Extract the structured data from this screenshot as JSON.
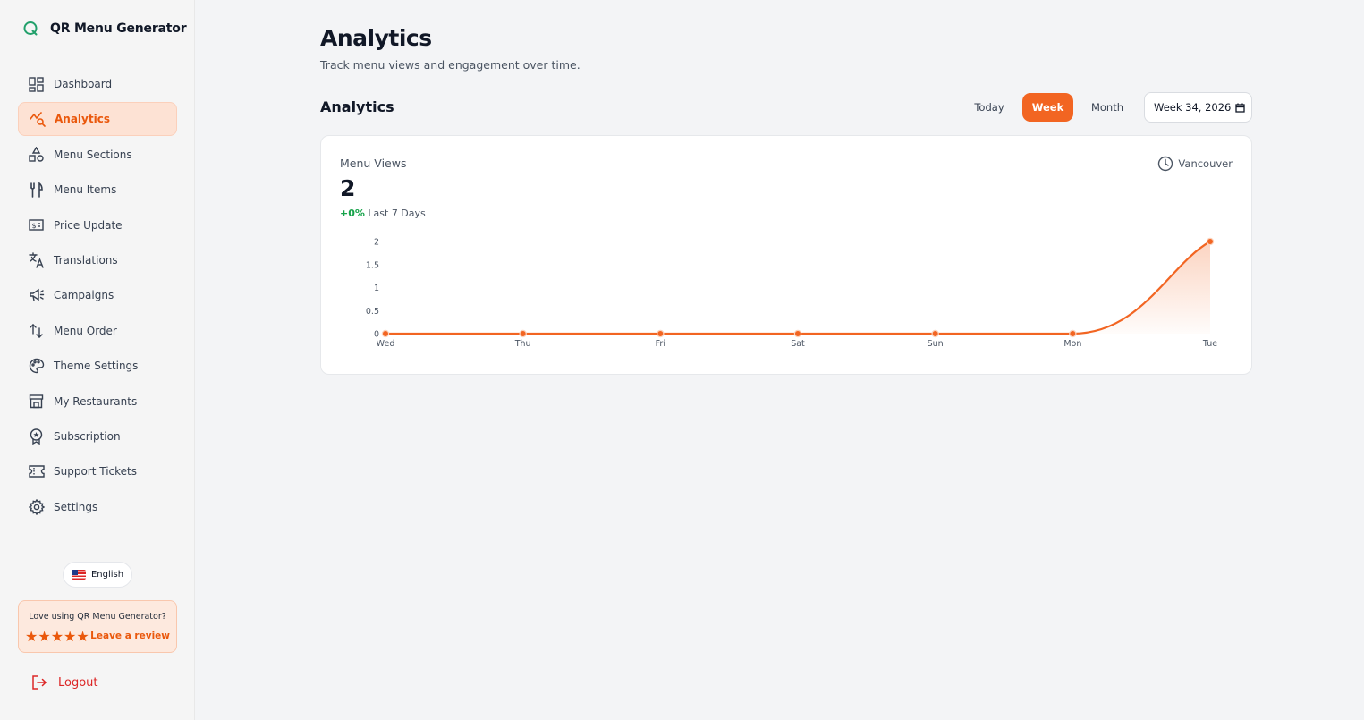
{
  "brand": {
    "name": "QR Menu Generator"
  },
  "sidebar": {
    "items": [
      {
        "label": "Dashboard",
        "icon": "dashboard-icon"
      },
      {
        "label": "Analytics",
        "icon": "analytics-icon",
        "active": true
      },
      {
        "label": "Menu Sections",
        "icon": "shapes-icon"
      },
      {
        "label": "Menu Items",
        "icon": "utensils-icon"
      },
      {
        "label": "Price Update",
        "icon": "price-tag-icon"
      },
      {
        "label": "Translations",
        "icon": "translate-icon"
      },
      {
        "label": "Campaigns",
        "icon": "megaphone-icon"
      },
      {
        "label": "Menu Order",
        "icon": "sort-arrows-icon"
      },
      {
        "label": "Theme Settings",
        "icon": "palette-icon"
      },
      {
        "label": "My Restaurants",
        "icon": "store-icon"
      },
      {
        "label": "Subscription",
        "icon": "badge-icon"
      },
      {
        "label": "Support Tickets",
        "icon": "ticket-icon"
      },
      {
        "label": "Settings",
        "icon": "gear-icon"
      }
    ],
    "language": "English",
    "review": {
      "question": "Love using QR Menu Generator?",
      "stars": "★★★★★",
      "cta": "Leave a review"
    },
    "logout": "Logout"
  },
  "header": {
    "title": "Analytics",
    "subtitle": "Track menu views and engagement over time."
  },
  "section": {
    "title": "Analytics",
    "ranges": [
      "Today",
      "Week",
      "Month"
    ],
    "selected_range": "Week",
    "date_value": "Week 34, 2026"
  },
  "metric": {
    "label": "Menu Views",
    "value": "2",
    "delta": "+0%",
    "period": "Last 7 Days",
    "timezone": "Vancouver"
  },
  "colors": {
    "accent": "#f26522",
    "positive": "#16a34a",
    "danger": "#dc2626"
  },
  "chart_data": {
    "type": "line",
    "categories": [
      "Wed",
      "Thu",
      "Fri",
      "Sat",
      "Sun",
      "Mon",
      "Tue"
    ],
    "series": [
      {
        "values": [
          0,
          0,
          0,
          0,
          0,
          0,
          2
        ]
      }
    ],
    "yticks": [
      "2",
      "1.5",
      "1",
      "0.5",
      "0"
    ],
    "ylim": [
      0,
      2
    ],
    "grid": false,
    "legend": "none"
  }
}
